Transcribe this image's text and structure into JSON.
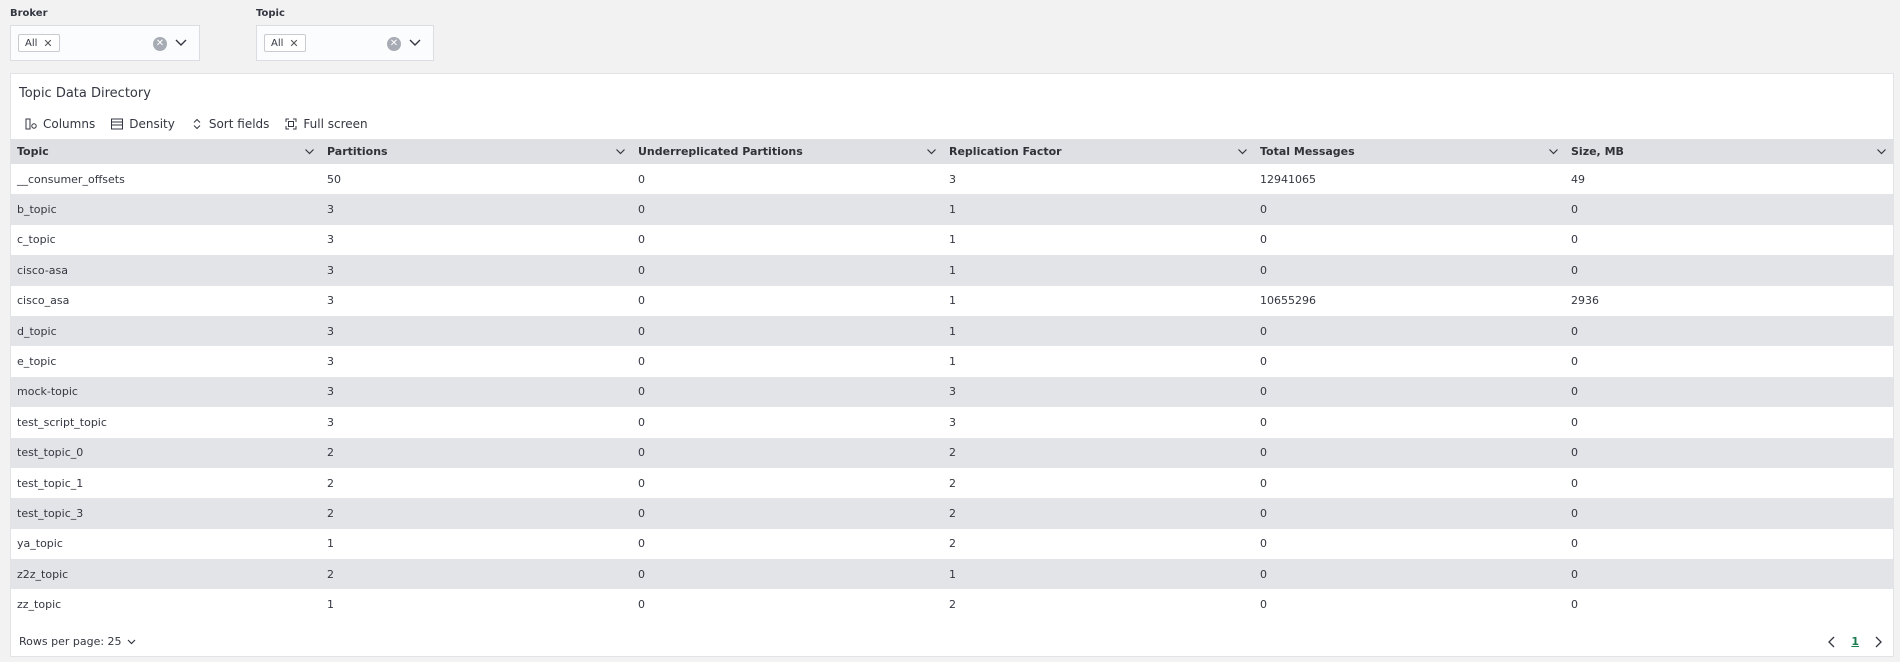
{
  "filters": [
    {
      "label": "Broker",
      "chip": "All"
    },
    {
      "label": "Topic",
      "chip": "All"
    }
  ],
  "panel": {
    "title": "Topic Data Directory",
    "toolbar": {
      "columns": "Columns",
      "density": "Density",
      "sort_fields": "Sort fields",
      "full_screen": "Full screen"
    }
  },
  "table": {
    "headers": [
      "Topic",
      "Partitions",
      "Underreplicated Partitions",
      "Replication Factor",
      "Total Messages",
      "Size, MB"
    ],
    "rows": [
      [
        "__consumer_offsets",
        "50",
        "0",
        "3",
        "12941065",
        "49"
      ],
      [
        "b_topic",
        "3",
        "0",
        "1",
        "0",
        "0"
      ],
      [
        "c_topic",
        "3",
        "0",
        "1",
        "0",
        "0"
      ],
      [
        "cisco-asa",
        "3",
        "0",
        "1",
        "0",
        "0"
      ],
      [
        "cisco_asa",
        "3",
        "0",
        "1",
        "10655296",
        "2936"
      ],
      [
        "d_topic",
        "3",
        "0",
        "1",
        "0",
        "0"
      ],
      [
        "e_topic",
        "3",
        "0",
        "1",
        "0",
        "0"
      ],
      [
        "mock-topic",
        "3",
        "0",
        "3",
        "0",
        "0"
      ],
      [
        "test_script_topic",
        "3",
        "0",
        "3",
        "0",
        "0"
      ],
      [
        "test_topic_0",
        "2",
        "0",
        "2",
        "0",
        "0"
      ],
      [
        "test_topic_1",
        "2",
        "0",
        "2",
        "0",
        "0"
      ],
      [
        "test_topic_3",
        "2",
        "0",
        "2",
        "0",
        "0"
      ],
      [
        "ya_topic",
        "1",
        "0",
        "2",
        "0",
        "0"
      ],
      [
        "z2z_topic",
        "2",
        "0",
        "1",
        "0",
        "0"
      ],
      [
        "zz_topic",
        "1",
        "0",
        "2",
        "0",
        "0"
      ]
    ]
  },
  "footer": {
    "rows_per_page": "Rows per page: 25",
    "current_page": "1"
  }
}
